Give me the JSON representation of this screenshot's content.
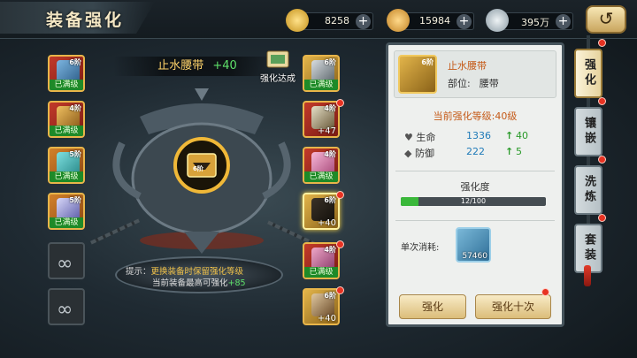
{
  "header": {
    "title": "装备强化",
    "currencies": [
      {
        "icon": "gold-ingot-icon",
        "value": "8258",
        "color": "#f0c24a"
      },
      {
        "icon": "gift-card-icon",
        "value": "15984",
        "color": "#f1b44c"
      },
      {
        "icon": "silver-coin-icon",
        "value": "395万",
        "color": "#b8c4cc"
      }
    ],
    "back_icon": "back-arrow-icon"
  },
  "left_slots": [
    {
      "level": "6阶",
      "tag": "已满级",
      "tier": "red"
    },
    {
      "level": "4阶",
      "tag": "已满级",
      "tier": "red"
    },
    {
      "level": "5阶",
      "tag": "已满级",
      "tier": "orange"
    },
    {
      "level": "5阶",
      "tag": "已满级",
      "tier": "orange"
    },
    {
      "tier": "empty",
      "icon": "ring-icon"
    },
    {
      "tier": "empty",
      "icon": "ring-icon"
    }
  ],
  "right_slots": [
    {
      "level": "6阶",
      "tag": "已满级",
      "tier": "gold"
    },
    {
      "level": "4阶",
      "tag": "+47",
      "tier": "red"
    },
    {
      "level": "4阶",
      "tag": "已满级",
      "tier": "red"
    },
    {
      "level": "6阶",
      "tag": "+40",
      "tier": "gold"
    },
    {
      "level": "4阶",
      "tag": "已满级",
      "tier": "red"
    },
    {
      "level": "6阶",
      "tag": "+40",
      "tier": "gold"
    }
  ],
  "center": {
    "item_name": "止水腰带",
    "item_bonus": "+40",
    "badge_label": "强化达成",
    "slot_level": "6阶",
    "hint_prefix": "提示：",
    "hint_line1": "更换装备时保留强化等级",
    "hint_line2": "当前装备最高可强化",
    "hint_value": "+85"
  },
  "panel": {
    "item_name": "止水腰带",
    "item_level": "6阶",
    "part_label": "部位:",
    "part_value": "腰带",
    "level_label": "当前强化等级:",
    "level_value": "40级",
    "stats": [
      {
        "label": "生命",
        "icon": "heart-icon",
        "value": "1336",
        "delta": "40"
      },
      {
        "label": "防御",
        "icon": "shield-icon",
        "value": "222",
        "delta": "5"
      }
    ],
    "progress_title": "强化度",
    "progress_text": "12/100",
    "progress_value": 0.12,
    "cost_label": "单次消耗:",
    "cost_amount": "57460",
    "btn_once": "强化",
    "btn_ten": "强化十次"
  },
  "tabs": [
    {
      "label": "强化",
      "active": true
    },
    {
      "label": "镶嵌",
      "active": false
    },
    {
      "label": "洗炼",
      "active": false
    },
    {
      "label": "套装",
      "active": false
    }
  ]
}
